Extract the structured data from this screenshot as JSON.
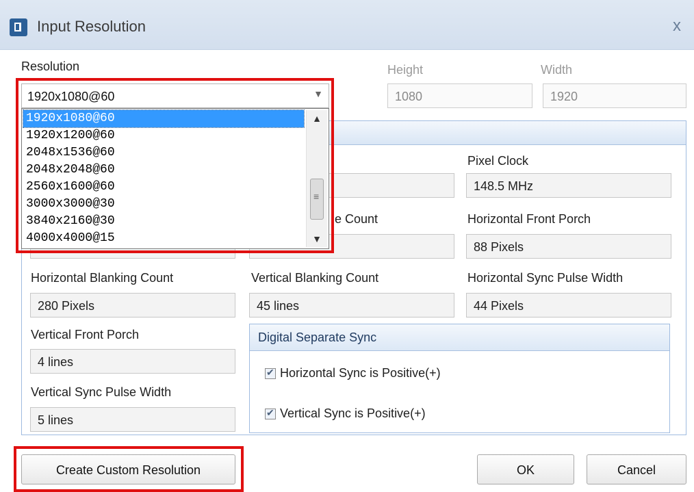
{
  "window": {
    "title": "Input Resolution",
    "close_glyph": "x",
    "icon": "app-icon"
  },
  "resolution": {
    "label": "Resolution",
    "selected": "1920x1080@60",
    "options": [
      "1920x1080@60",
      "1920x1200@60",
      "2048x1536@60",
      "2048x2048@60",
      "2560x1600@60",
      "3000x3000@30",
      "3840x2160@30",
      "4000x4000@15"
    ]
  },
  "height": {
    "label": "Height",
    "value": "1080"
  },
  "width": {
    "label": "Width",
    "value": "1920"
  },
  "timing": {
    "pixel_clock": {
      "label": "Pixel Clock",
      "value": "148.5 MHz"
    },
    "vline_count_partial": "e Count",
    "h_front_porch": {
      "label": "Horizontal Front Porch",
      "value": "88 Pixels"
    },
    "h_blanking": {
      "label": "Horizontal Blanking Count",
      "value": "280 Pixels"
    },
    "v_blanking": {
      "label": "Vertical Blanking Count",
      "value": "45 lines"
    },
    "h_sync_width": {
      "label": "Horizontal Sync Pulse Width",
      "value": "44 Pixels"
    },
    "v_front_porch": {
      "label": "Vertical Front Porch",
      "value": "4 lines"
    },
    "v_sync_width": {
      "label": "Vertical Sync Pulse Width",
      "value": "5 lines"
    }
  },
  "sync": {
    "title": "Digital Separate Sync",
    "h_positive": {
      "label": "Horizontal Sync is Positive(+)",
      "checked": true
    },
    "v_positive": {
      "label": "Vertical Sync is Positive(+)",
      "checked": true
    }
  },
  "buttons": {
    "create_custom": "Create Custom Resolution",
    "ok": "OK",
    "cancel": "Cancel"
  },
  "colors": {
    "highlight": "#e01010",
    "selection": "#3399ff",
    "group_header": "#d9e6f5"
  }
}
